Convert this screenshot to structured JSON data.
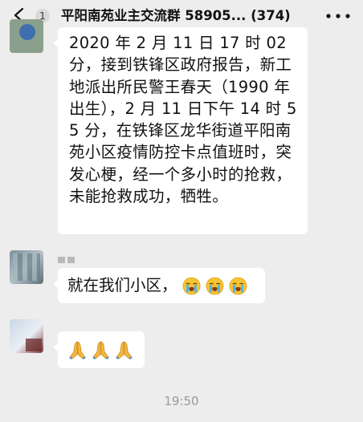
{
  "header": {
    "unread_count": "1",
    "title": "平阳南苑业主交流群 58905... (374)"
  },
  "messages": [
    {
      "text": "2020 年 2 月 11 日 17 时 02 分，接到铁锋区政府报告，新工地派出所民警王春天（1990 年出生），2 月 11 日下午 14 时 55 分，在铁锋区龙华街道平阳南苑小区疫情防控卡点值班时，突发心梗，经一个多小时的抢救，未能抢救成功，牺牲。"
    },
    {
      "text": "就在我们小区，",
      "emojis": [
        "crying-face-icon",
        "crying-face-icon",
        "crying-face-icon"
      ]
    },
    {
      "text": "",
      "emojis": [
        "folded-hands-icon",
        "folded-hands-icon",
        "folded-hands-icon"
      ]
    }
  ],
  "timestamp": "19:50",
  "colors": {
    "background": "#ededed",
    "bubble": "#ffffff",
    "timestamp": "#9a9a9a"
  }
}
